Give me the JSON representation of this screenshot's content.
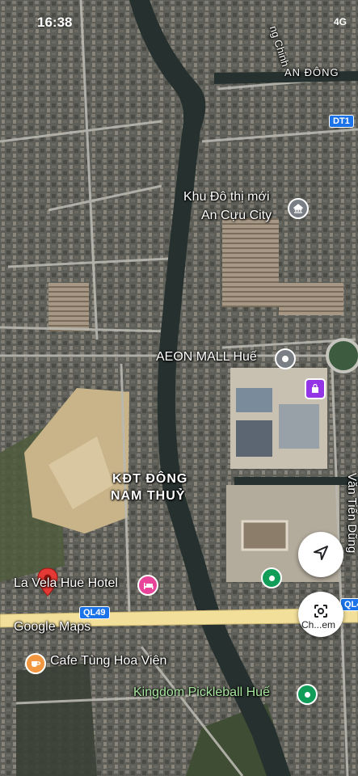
{
  "status_bar": {
    "time": "16:38",
    "signal": "4G"
  },
  "map_labels": {
    "an_dong": "AN ĐÔNG",
    "dt1": "DT1",
    "an_cuu_line1": "Khu Đô thị mới",
    "an_cuu_line2": "An Cựu City",
    "aeon": "AEON MALL Huế",
    "kdt_line1": "KĐT ĐÔNG",
    "kdt_line2": "NAM THUỶ",
    "hotel": "La Vela Hue Hotel",
    "ql49": "QL49",
    "google_maps": "Google Maps",
    "cafe": "Cafe Tùng Hoa Viên",
    "pickleball": "Kingdom Pickleball Huế",
    "van_tien_dung": "Văn Tiến Dũng",
    "ql4_partial": "QL4",
    "road_top_partial": "ng Chinh",
    "chat_label": "Ch...em"
  },
  "colors": {
    "river": "#26302e",
    "road": "#c9c9c4",
    "pin_red": "#e53935",
    "pin_green": "#0f9d58",
    "pin_gray": "#7a7f85",
    "pin_purple": "#9334e6",
    "pin_pink": "#e8449a",
    "pin_orange": "#f29741",
    "highway": "#f2df9a"
  },
  "icons": [
    "location-arrow-icon",
    "lens-icon",
    "red-location-pin",
    "hotel-pin-icon",
    "cafe-pin-icon",
    "mall-pin-icon",
    "shopping-pin-icon",
    "pickleball-pin-icon",
    "gov-building-pin-icon"
  ]
}
